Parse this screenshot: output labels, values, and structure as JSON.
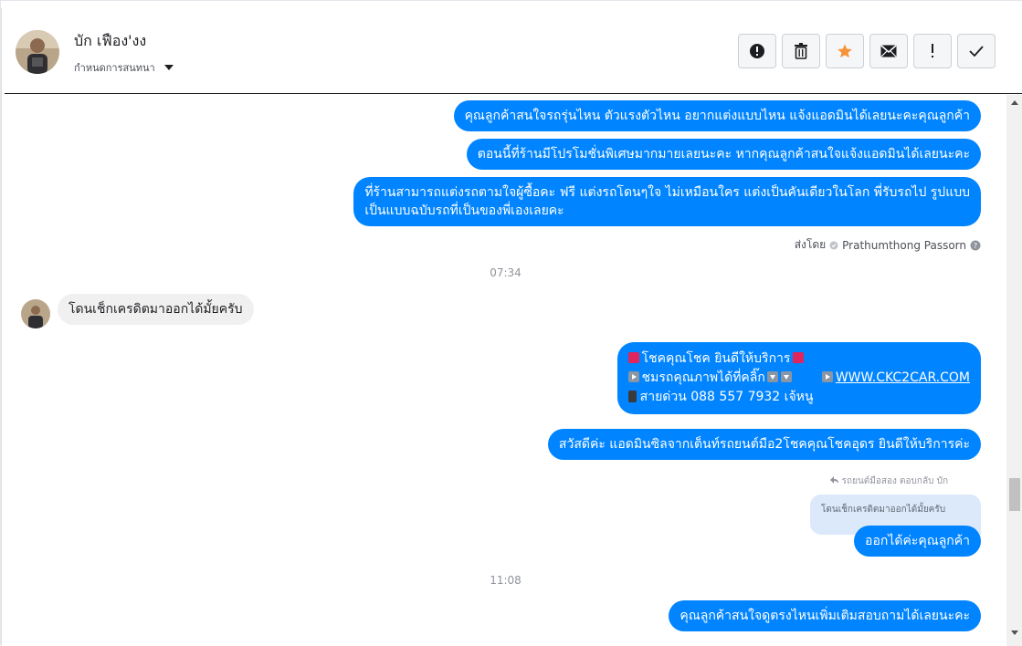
{
  "header": {
    "name": "บัก เฟือง'งง",
    "settings_label": "กำหนดการสนทนา",
    "actions": [
      {
        "icon": "alert-circle-icon",
        "name": "mark-spam-button"
      },
      {
        "icon": "trash-icon",
        "name": "delete-button"
      },
      {
        "icon": "star-icon",
        "name": "star-button",
        "color": "#f7923b"
      },
      {
        "icon": "envelope-icon",
        "name": "mark-unread-button"
      },
      {
        "icon": "exclamation-icon",
        "name": "follow-up-button"
      },
      {
        "icon": "checkmark-icon",
        "name": "mark-done-button"
      }
    ]
  },
  "messages": {
    "m1": "คุณลูกค้าสนใจรถรุ่นไหน ตัวแรงตัวไหน อยากแต่งแบบไหน แจ้งแอดมินได้เลยนะคะคุณลูกค้า",
    "m2": "ตอนนี้ที่ร้านมีโปรโมชั่นพิเศษมากมายเลยนะคะ หากคุณลูกค้าสนใจแจ้งแอดมินได้เลยนะคะ",
    "m3_line1": "ที่ร้านสามารถแต่งรถตามใจผู้ซื้อคะ ฟรี แต่งรถโดนๆใจ ไม่เหมือนใคร แต่งเป็นคันเดียวในโลก พี่รับรถไป รูปแบบ",
    "m3_line2": "เป็นแบบฉบับรถที่เป็นของพี่เองเลยคะ",
    "sent_by_label": "ส่งโดย",
    "sent_by_name": "Prathumthong Passorn",
    "time1": "07:34",
    "incoming1": "โดนเช็กเครดิตมาออกได้มั้ยครับ",
    "m4_line1": "โชคคุณโชค ยินดีให้บริการ",
    "m4_line2": "ชมรถคุณภาพได้ที่คลิ๊ก",
    "m4_link": "WWW.CKC2CAR.COM",
    "m4_line3": "สายด่วน 088 557 7932 เจ้หนู",
    "m5": "สวัสดีค่ะ แอดมินซิลจากเต็นท์รถยนต์มือ2โชคคุณโชคอุดร ยินดีให้บริการค่ะ",
    "reply_note": "รถยนต์มือสอง ตอบกลับ บัก",
    "reply_quote": "โดนเช็กเครดิตมาออกได้มั้ยครับ",
    "m6": "ออกได้ค่ะคุณลูกค้า",
    "time2": "11:08",
    "m7": "คุณลูกค้าสนใจดูตรงไหนเพิ่มเติมสอบถามได้เลยนะคะ"
  },
  "colors": {
    "outgoing_bubble": "#0084ff",
    "incoming_bubble": "#f1f0f0",
    "reply_quote_bg": "#dbe9fb"
  }
}
